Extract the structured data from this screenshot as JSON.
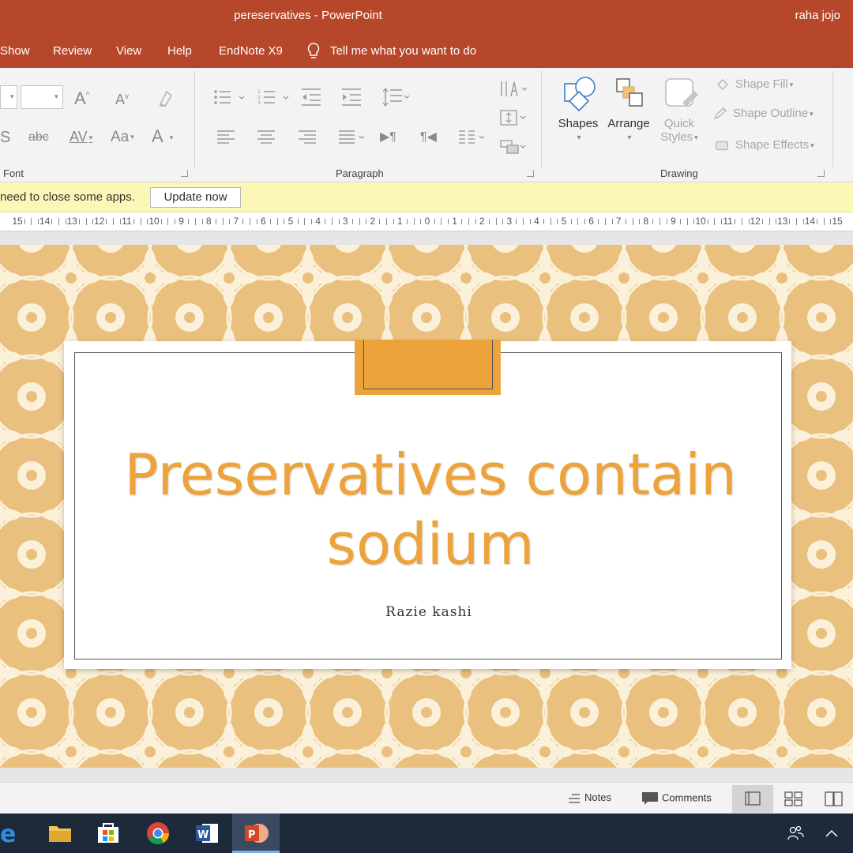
{
  "window": {
    "doc_title": "pereservatives  -  PowerPoint",
    "user": "raha jojo"
  },
  "menu": {
    "tabs": [
      "Show",
      "Review",
      "View",
      "Help",
      "EndNote X9"
    ],
    "tell_me": "Tell me what you want to do"
  },
  "ribbon": {
    "groups": {
      "font": "Font",
      "paragraph": "Paragraph",
      "drawing": "Drawing"
    },
    "font_glyphs": {
      "grow": "A",
      "shrink": "A",
      "strike": "abc",
      "spacing": "AV",
      "change_case": "Aa",
      "font_color": "A"
    },
    "drawing": {
      "shapes": "Shapes",
      "arrange": "Arrange",
      "quick_styles_1": "Quick",
      "quick_styles_2": "Styles",
      "shape_fill": "Shape Fill",
      "shape_outline": "Shape Outline",
      "shape_effects": "Shape Effects"
    }
  },
  "message_bar": {
    "text": "need to close some apps.",
    "button": "Update now"
  },
  "ruler": {
    "labels": [
      "15",
      "14",
      "13",
      "12",
      "11",
      "10",
      "9",
      "8",
      "7",
      "6",
      "5",
      "4",
      "3",
      "2",
      "1",
      "0",
      "1",
      "2",
      "3",
      "4",
      "5",
      "6",
      "7",
      "8",
      "9",
      "10",
      "11",
      "12",
      "13",
      "14",
      "15"
    ]
  },
  "slide": {
    "title": "Preservatives contain sodium",
    "subtitle": "Razie kashi"
  },
  "status_bar": {
    "notes": "Notes",
    "comments": "Comments"
  },
  "colors": {
    "title_bar": "#b7472a",
    "accent": "#eda33b",
    "background_pattern": "#e9c07d",
    "pattern_motif": "#fbf1da",
    "message_bar": "#fcf7b6",
    "taskbar": "#1d2a3a"
  },
  "taskbar": {
    "apps": [
      "edge-icon",
      "file-explorer-icon",
      "store-icon",
      "chrome-icon",
      "word-icon",
      "powerpoint-icon"
    ]
  }
}
